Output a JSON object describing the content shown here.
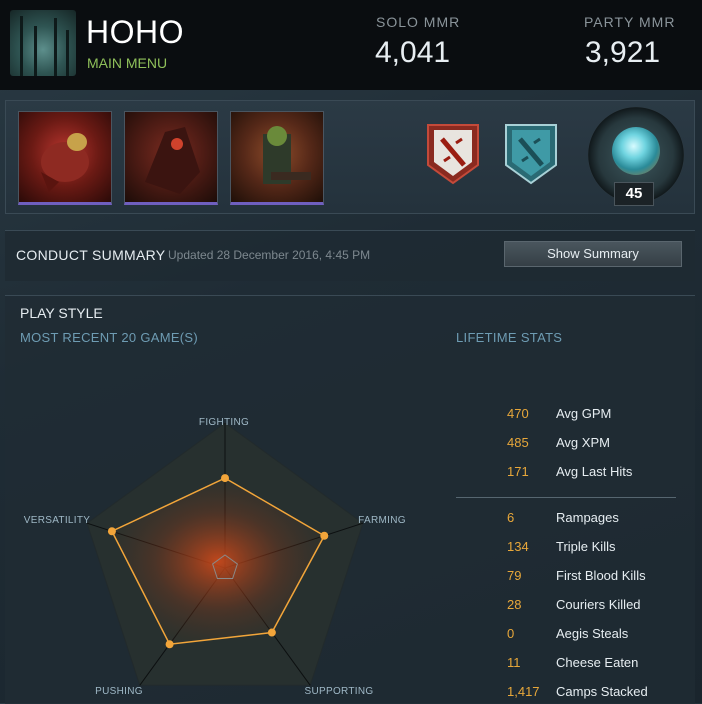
{
  "player": {
    "name": "HOHO",
    "status": "MAIN MENU"
  },
  "mmr": {
    "solo_label": "SOLO MMR",
    "solo_value": "4,041",
    "party_label": "PARTY MMR",
    "party_value": "3,921"
  },
  "level": "45",
  "conduct": {
    "title": "CONDUCT SUMMARY",
    "updated": "Updated 28 December 2016, 4:45 PM",
    "button": "Show Summary"
  },
  "play_style": {
    "title": "PLAY STYLE",
    "recent": "MOST RECENT 20 GAME(S)",
    "lifetime": "LIFETIME STATS",
    "axes": [
      "FIGHTING",
      "FARMING",
      "SUPPORTING",
      "PUSHING",
      "VERSATILITY"
    ],
    "axis_values": [
      0.62,
      0.72,
      0.55,
      0.65,
      0.82
    ]
  },
  "stats": [
    {
      "value": "470",
      "label": "Avg GPM"
    },
    {
      "value": "485",
      "label": "Avg XPM"
    },
    {
      "value": "171",
      "label": "Avg Last Hits"
    },
    {
      "value": "6",
      "label": "Rampages"
    },
    {
      "value": "134",
      "label": "Triple Kills"
    },
    {
      "value": "79",
      "label": "First Blood Kills"
    },
    {
      "value": "28",
      "label": "Couriers Killed"
    },
    {
      "value": "0",
      "label": "Aegis Steals"
    },
    {
      "value": "11",
      "label": "Cheese Eaten"
    },
    {
      "value": "1,417",
      "label": "Camps Stacked"
    }
  ],
  "colors": {
    "accent": "#e7a73a",
    "status": "#8fc05a",
    "link": "#6e9cb3"
  }
}
